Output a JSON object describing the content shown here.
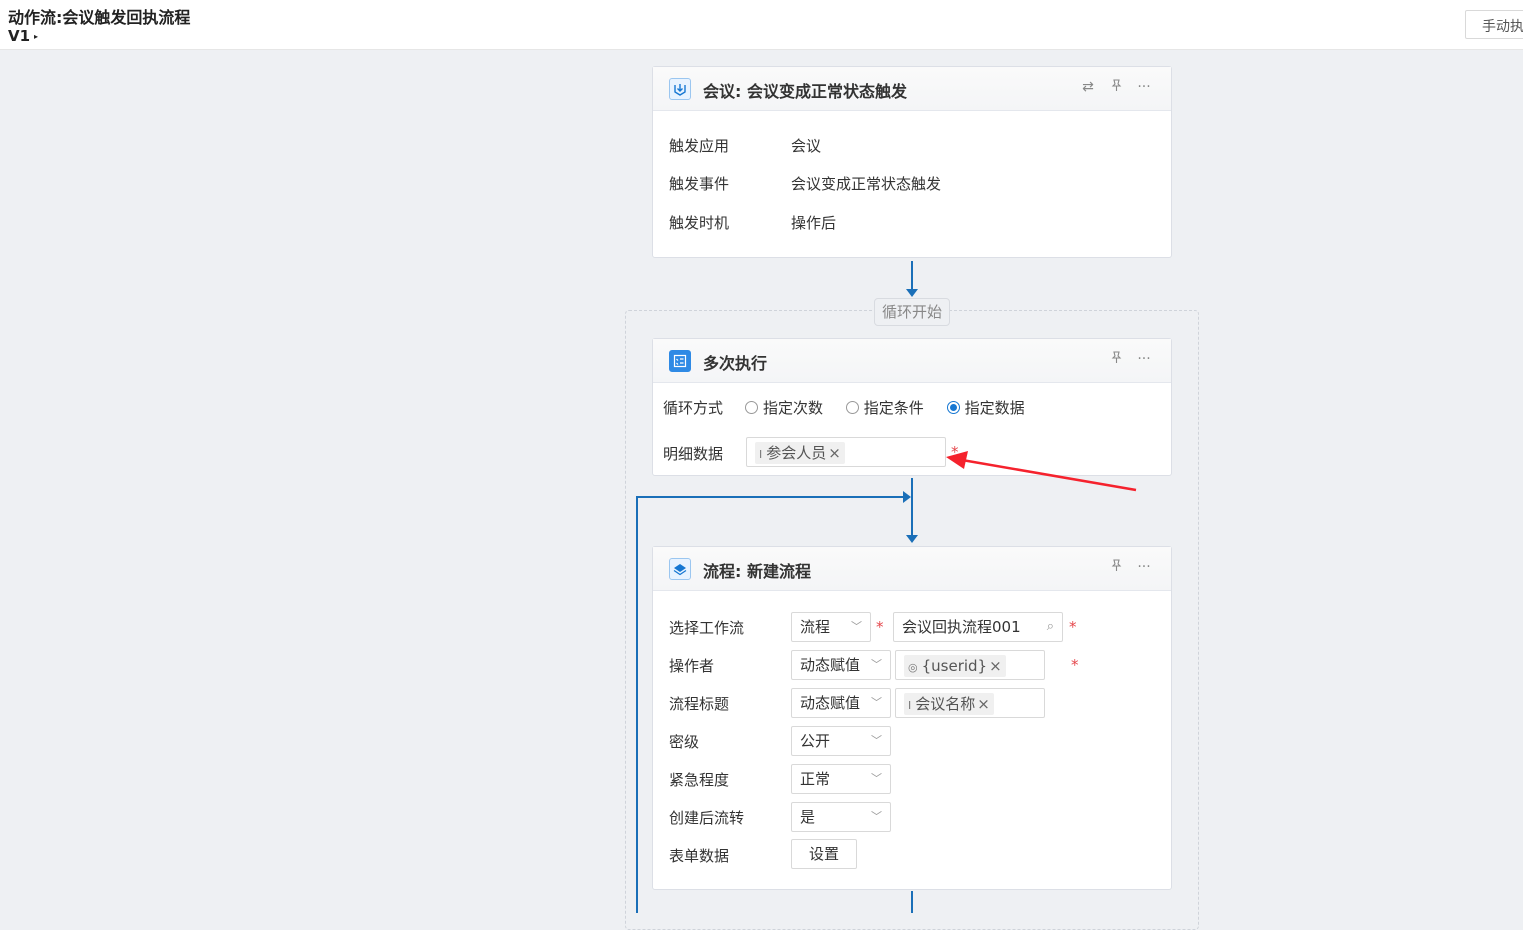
{
  "header": {
    "title": "动作流:会议触发回执流程",
    "version": "V1",
    "manual_button": "手动执行"
  },
  "trigger_card": {
    "title": "会议: 会议变成正常状态触发",
    "rows": [
      {
        "label": "触发应用",
        "value": "会议"
      },
      {
        "label": "触发事件",
        "value": "会议变成正常状态触发"
      },
      {
        "label": "触发时机",
        "value": "操作后"
      }
    ]
  },
  "loop": {
    "start_label": "循环开始"
  },
  "loop_card": {
    "title": "多次执行",
    "mode_label": "循环方式",
    "options": [
      "指定次数",
      "指定条件",
      "指定数据"
    ],
    "selected_option": "指定数据",
    "detail_label": "明细数据",
    "detail_tag": "参会人员"
  },
  "workflow_card": {
    "title": "流程: 新建流程",
    "select_workflow_label": "选择工作流",
    "workflow_type": "流程",
    "workflow_name": "会议回执流程001",
    "operator_label": "操作者",
    "operator_mode": "动态赋值",
    "operator_tag": "{userid}",
    "flow_title_label": "流程标题",
    "flow_title_mode": "动态赋值",
    "flow_title_tag": "会议名称",
    "secret_label": "密级",
    "secret_value": "公开",
    "urgency_label": "紧急程度",
    "urgency_value": "正常",
    "after_create_label": "创建后流转",
    "after_create_value": "是",
    "form_data_label": "表单数据",
    "form_data_button": "设置"
  },
  "colors": {
    "accent": "#1677d2",
    "connector": "#1a6fb8",
    "required": "#e5484d",
    "annotation_arrow": "#f5222d"
  }
}
